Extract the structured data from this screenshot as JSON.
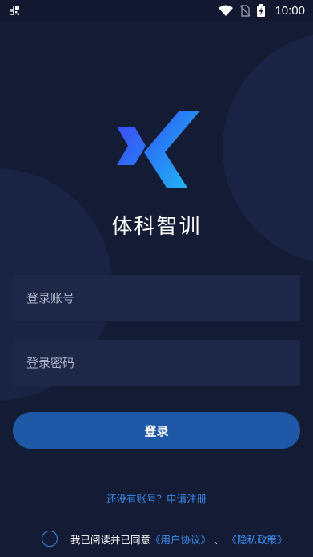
{
  "status_bar": {
    "time": "10:00",
    "icons": [
      "qr-grid-icon",
      "wifi-icon",
      "no-sim-icon",
      "battery-charging-icon"
    ]
  },
  "brand": {
    "logo_icon": "x-chevron-logo-icon",
    "app_name": "体科智训",
    "logo_colors": [
      "#2f55f5",
      "#1fb3f7"
    ]
  },
  "form": {
    "account_placeholder": "登录账号",
    "password_placeholder": "登录密码",
    "login_label": "登录"
  },
  "links": {
    "register": "还没有账号？申请注册"
  },
  "agreement": {
    "prefix": "我已阅读并已同意",
    "user_agreement": "《用户协议》",
    "separator": "、",
    "privacy_policy": "《隐私政策》"
  },
  "colors": {
    "background": "#141c35",
    "accent": "#3c8cf0",
    "button": "#1e58a6",
    "field": "#1e2747"
  }
}
